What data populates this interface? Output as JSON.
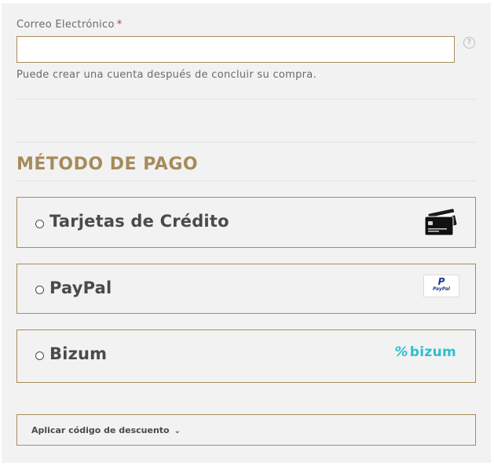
{
  "email": {
    "label": "Correo Electrónico",
    "required_mark": "*",
    "value": "",
    "placeholder": "",
    "help_icon": "question-circle-icon",
    "note": "Puede crear una cuenta después de concluir su compra."
  },
  "payment": {
    "title": "MÉTODO DE PAGO",
    "options": [
      {
        "label": "Tarjetas de Crédito",
        "icon": "credit-cards-icon",
        "selected": false
      },
      {
        "label": "PayPal",
        "icon": "paypal-logo",
        "selected": false
      },
      {
        "label": "Bizum",
        "icon": "bizum-logo",
        "selected": false
      }
    ],
    "bizum_logo_text": "bizum",
    "bizum_logo_mark": "%",
    "paypal_logo_text": "PayPal",
    "paypal_logo_mark": "P"
  },
  "discount": {
    "label": "Aplicar código de descuento",
    "chevron_icon": "chevron-down-icon"
  },
  "colors": {
    "accent": "#a68b5b",
    "panel_bg": "#f2f2f2",
    "text": "#4a4a4a",
    "muted": "#6b6b6b",
    "bizum": "#2bc0d0",
    "paypal_dark": "#1f3a8a",
    "paypal_light": "#2d9fd9"
  }
}
